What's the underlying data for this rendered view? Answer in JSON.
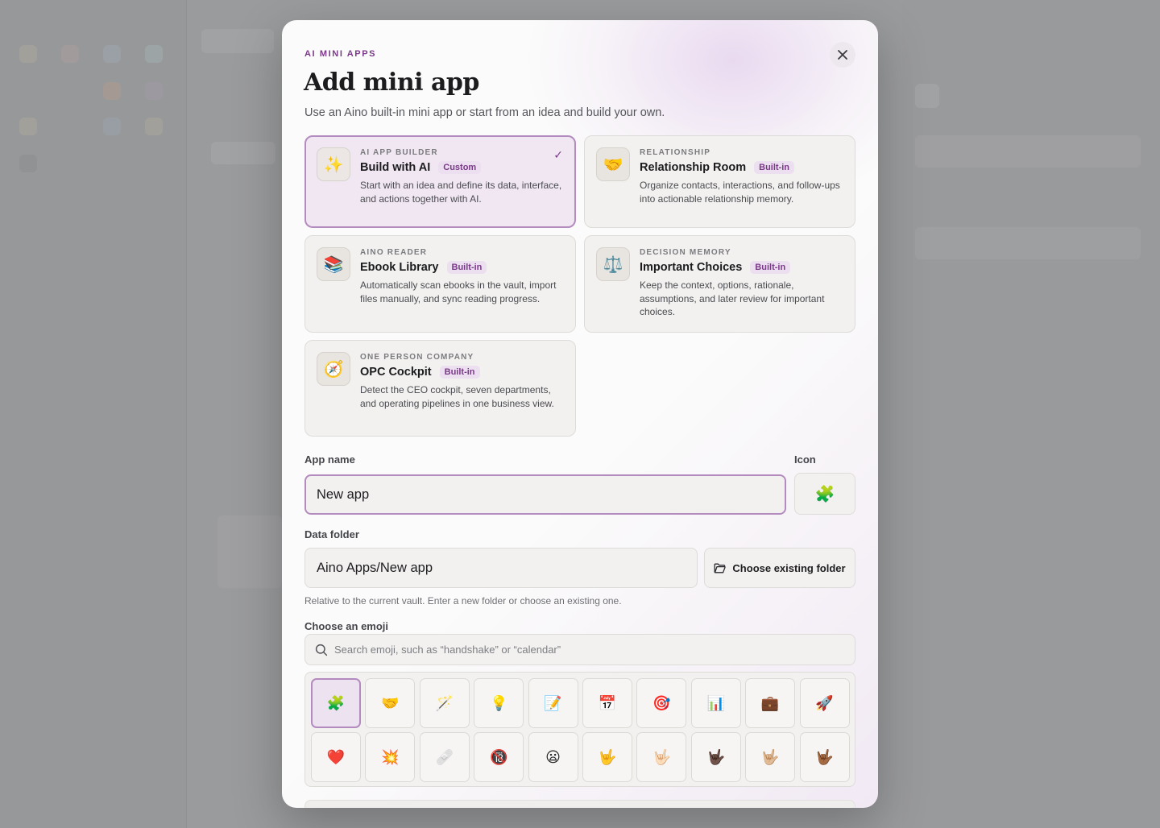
{
  "modal": {
    "eyebrow": "AI MINI APPS",
    "title": "Add mini app",
    "subtitle": "Use an Aino built-in mini app or start from an idea and build your own.",
    "close_icon": "close-icon"
  },
  "templates": [
    {
      "kicker": "AI APP BUILDER",
      "title": "Build with AI",
      "badge": "Custom",
      "desc": "Start with an idea and define its data, interface, and actions together with AI.",
      "emoji": "✨",
      "selected": true,
      "check": "✓"
    },
    {
      "kicker": "RELATIONSHIP",
      "title": "Relationship Room",
      "badge": "Built-in",
      "desc": "Organize contacts, interactions, and follow-ups into actionable relationship memory.",
      "emoji": "🤝",
      "selected": false
    },
    {
      "kicker": "AINO READER",
      "title": "Ebook Library",
      "badge": "Built-in",
      "desc": "Automatically scan ebooks in the vault, import files manually, and sync reading progress.",
      "emoji": "📚",
      "selected": false
    },
    {
      "kicker": "DECISION MEMORY",
      "title": "Important Choices",
      "badge": "Built-in",
      "desc": "Keep the context, options, rationale, assumptions, and later review for important choices.",
      "emoji": "⚖️",
      "selected": false
    },
    {
      "kicker": "ONE PERSON COMPANY",
      "title": "OPC Cockpit",
      "badge": "Built-in",
      "desc": "Detect the CEO cockpit, seven departments, and operating pipelines in one business view.",
      "emoji": "🧭",
      "selected": false
    }
  ],
  "form": {
    "app_name_label": "App name",
    "app_name_value": "New app",
    "icon_label": "Icon",
    "icon_value": "🧩",
    "data_folder_label": "Data folder",
    "data_folder_value": "Aino Apps/New app",
    "choose_folder_label": "Choose existing folder",
    "folder_hint": "Relative to the current vault. Enter a new folder or choose an existing one.",
    "emoji_label": "Choose an emoji",
    "emoji_search_placeholder": "Search emoji, such as “handshake” or “calendar”"
  },
  "emojis": [
    "🧩",
    "🤝",
    "🪄",
    "💡",
    "📝",
    "📅",
    "🎯",
    "📊",
    "💼",
    "🚀",
    "❤️",
    "💥",
    "🩹",
    "🔞",
    "😦",
    "🤟",
    "🤟🏻",
    "🤟🏿",
    "🤟🏼",
    "🤟🏾"
  ],
  "selected_emoji_index": 0,
  "colors": {
    "accent": "#7a3a88",
    "accent_border": "#b48bbf",
    "badge_bg": "#ecdff0"
  }
}
